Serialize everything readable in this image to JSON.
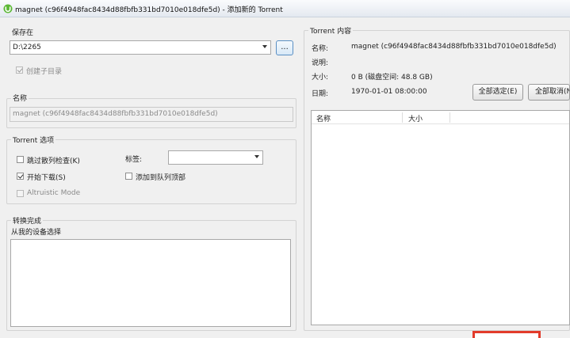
{
  "window": {
    "title": "magnet (c96f4948fac8434d88fbfb331bd7010e018dfe5d) - 添加新的 Torrent"
  },
  "save_location": {
    "group_label": "保存在",
    "path_value": "D:\\2265",
    "browse_label": "...",
    "create_subfolder_label": "创建子目录",
    "create_subfolder_checked": true
  },
  "name_section": {
    "group_label": "名称",
    "value": "magnet (c96f4948fac8434d88fbfb331bd7010e018dfe5d)"
  },
  "torrent_options": {
    "group_label": "Torrent 选项",
    "skip_hash_check_label": "跳过散列检查(K)",
    "skip_hash_check_checked": false,
    "start_download_label": "开始下载(S)",
    "start_download_checked": true,
    "altruistic_label": "Altruistic Mode",
    "altruistic_checked": false,
    "tag_label": "标签:",
    "tag_value": "",
    "add_to_top_label": "添加到队列顶部",
    "add_to_top_checked": false
  },
  "convert_section": {
    "group_label": "转换完成",
    "device_label": "从我的设备选择"
  },
  "torrent_content": {
    "group_label": "Torrent 内容",
    "name_label": "名称:",
    "name_value": "magnet (c96f4948fac8434d88fbfb331bd7010e018dfe5d)",
    "desc_label": "说明:",
    "desc_value": "",
    "size_label": "大小:",
    "size_value": "0 B (磁盘空间: 48.8 GB)",
    "date_label": "日期:",
    "date_value": "1970-01-01 08:00:00",
    "select_all_label": "全部选定(E)",
    "select_none_label": "全部取消(N)",
    "columns": [
      "名称",
      "大小"
    ]
  },
  "colors": {
    "accent_border": "#5a8fc3",
    "watermark_red": "#e23b2b"
  }
}
